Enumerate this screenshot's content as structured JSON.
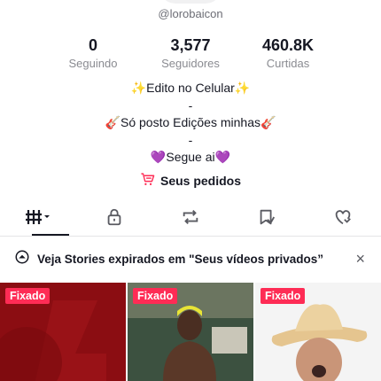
{
  "profile": {
    "username": "@lorobaicon",
    "stats": [
      {
        "value": "0",
        "label": "Seguindo"
      },
      {
        "value": "3,577",
        "label": "Seguidores"
      },
      {
        "value": "460.8K",
        "label": "Curtidas"
      }
    ],
    "bio_lines": [
      "✨Edito no Celular✨",
      "-",
      "🎸Só posto Edições minhas🎸",
      "-",
      "💜Segue ai💜"
    ],
    "orders_label": "Seus pedidos"
  },
  "tabs": [
    {
      "icon": "videos-grid-icon",
      "active": true
    },
    {
      "icon": "lock-icon",
      "active": false
    },
    {
      "icon": "repost-icon",
      "active": false
    },
    {
      "icon": "favorites-icon",
      "active": false
    },
    {
      "icon": "liked-icon",
      "active": false
    }
  ],
  "banner": {
    "text": "Veja Stories expirados em \"Seus vídeos privados”",
    "close": "×"
  },
  "videos": [
    {
      "badge": "Fixado"
    },
    {
      "badge": "Fixado"
    },
    {
      "badge": "Fixado"
    }
  ],
  "colors": {
    "accent": "#fe2c55",
    "text": "#161823",
    "muted": "#8a8b91"
  }
}
